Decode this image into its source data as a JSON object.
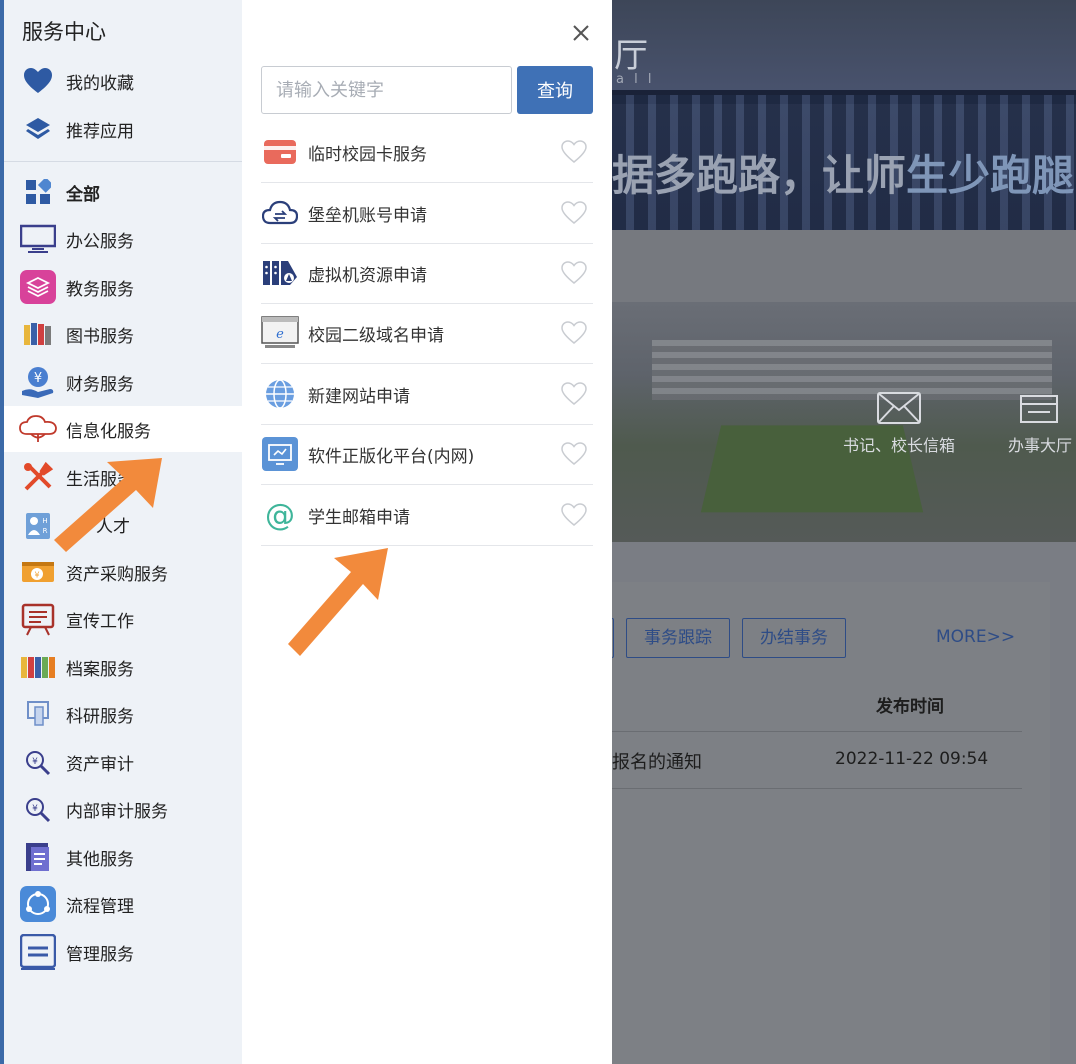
{
  "background": {
    "hall_title": "厅",
    "hall_subtitle": "a l l",
    "slogan_part1": "据多跑路，让师",
    "slogan_part2": "生少跑腿",
    "quick_links": [
      "书记、校长信箱",
      "办事大厅"
    ],
    "tabs": [
      "事务跟踪",
      "办结事务"
    ],
    "more_link": "MORE>>",
    "column_header": "发布时间",
    "notice_title": "报名的通知",
    "notice_date": "2022-11-22 09:54"
  },
  "sidebar": {
    "title": "服务中心",
    "items": [
      {
        "label": "我的收藏",
        "icon": "heart-icon"
      },
      {
        "label": "推荐应用",
        "icon": "layers-icon"
      },
      {
        "label": "全部",
        "icon": "grid-icon"
      },
      {
        "label": "办公服务",
        "icon": "monitor-icon"
      },
      {
        "label": "教务服务",
        "icon": "stack-icon"
      },
      {
        "label": "图书服务",
        "icon": "books-icon"
      },
      {
        "label": "财务服务",
        "icon": "yuan-hand-icon"
      },
      {
        "label": "信息化服务",
        "icon": "cloud-icon"
      },
      {
        "label": "生活服务",
        "icon": "tools-icon"
      },
      {
        "label": "人才",
        "icon": "hr-icon"
      },
      {
        "label": "资产采购服务",
        "icon": "money-icon"
      },
      {
        "label": "宣传工作",
        "icon": "easel-icon"
      },
      {
        "label": "档案服务",
        "icon": "binders-icon"
      },
      {
        "label": "科研服务",
        "icon": "research-icon"
      },
      {
        "label": "资产审计",
        "icon": "audit-icon"
      },
      {
        "label": "内部审计服务",
        "icon": "audit-search-icon"
      },
      {
        "label": "其他服务",
        "icon": "document-icon"
      },
      {
        "label": "流程管理",
        "icon": "process-icon"
      },
      {
        "label": "管理服务",
        "icon": "manage-icon"
      }
    ]
  },
  "list": {
    "search_placeholder": "请输入关键字",
    "search_button": "查询",
    "services": [
      {
        "label": "临时校园卡服务",
        "icon": "card-icon"
      },
      {
        "label": "堡垒机账号申请",
        "icon": "cloud-sync-icon"
      },
      {
        "label": "虚拟机资源申请",
        "icon": "server-icon"
      },
      {
        "label": "校园二级域名申请",
        "icon": "browser-icon"
      },
      {
        "label": "新建网站申请",
        "icon": "globe-icon"
      },
      {
        "label": "软件正版化平台(内网)",
        "icon": "software-icon"
      },
      {
        "label": "学生邮箱申请",
        "icon": "at-icon"
      }
    ]
  },
  "colors": {
    "accent": "#3f71b6",
    "arrow": "#f28a3c",
    "sidebar_bg": "#eef2f7"
  }
}
